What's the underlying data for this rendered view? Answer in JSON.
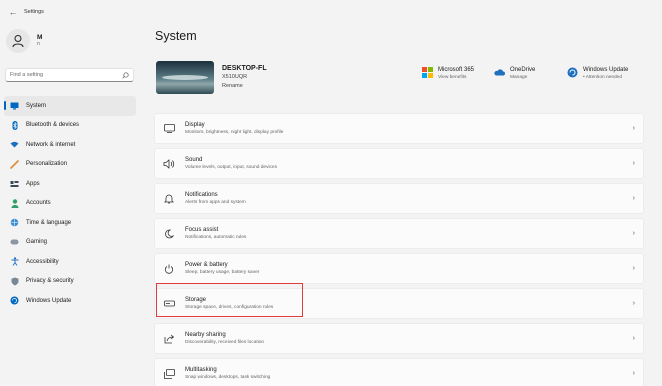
{
  "window": {
    "title": "Settings",
    "back_glyph": "←"
  },
  "user": {
    "name": "M",
    "sub": "n"
  },
  "search": {
    "placeholder": "Find a setting"
  },
  "nav": [
    {
      "label": "System",
      "icon": "monitor-icon",
      "active": true
    },
    {
      "label": "Bluetooth & devices",
      "icon": "bluetooth-icon"
    },
    {
      "label": "Network & internet",
      "icon": "network-icon"
    },
    {
      "label": "Personalization",
      "icon": "brush-icon"
    },
    {
      "label": "Apps",
      "icon": "apps-icon"
    },
    {
      "label": "Accounts",
      "icon": "accounts-icon"
    },
    {
      "label": "Time & language",
      "icon": "globe-clock-icon"
    },
    {
      "label": "Gaming",
      "icon": "gamepad-icon"
    },
    {
      "label": "Accessibility",
      "icon": "accessibility-icon"
    },
    {
      "label": "Privacy & security",
      "icon": "shield-icon"
    },
    {
      "label": "Windows Update",
      "icon": "update-icon"
    }
  ],
  "main": {
    "title": "System",
    "device": {
      "name": "DESKTOP-FL",
      "model": "X510UQR",
      "rename": "Rename"
    },
    "quick": [
      {
        "title": "Microsoft 365",
        "sub": "View benefits",
        "icon": "microsoft-logo-icon"
      },
      {
        "title": "OneDrive",
        "sub": "Manage",
        "icon": "cloud-icon"
      },
      {
        "title": "Windows Update",
        "sub": "• Attention needed",
        "icon": "update-icon"
      }
    ],
    "rows": [
      {
        "title": "Display",
        "sub": "Monitors, brightness, night light, display profile",
        "icon": "display-icon"
      },
      {
        "title": "Sound",
        "sub": "Volume levels, output, input, sound devices",
        "icon": "speaker-icon"
      },
      {
        "title": "Notifications",
        "sub": "Alerts from apps and system",
        "icon": "bell-icon"
      },
      {
        "title": "Focus assist",
        "sub": "Notifications, automatic rules",
        "icon": "moon-icon"
      },
      {
        "title": "Power & battery",
        "sub": "Sleep, battery usage, battery saver",
        "icon": "power-icon"
      },
      {
        "title": "Storage",
        "sub": "Storage space, drives, configuration rules",
        "icon": "storage-icon"
      },
      {
        "title": "Nearby sharing",
        "sub": "Discoverability, received files location",
        "icon": "share-icon"
      },
      {
        "title": "Multitasking",
        "sub": "Snap windows, desktops, task switching",
        "icon": "multitask-icon"
      }
    ],
    "chevron": "›"
  },
  "colors": {
    "accent": "#0067c0",
    "highlight": "#e23b3b"
  }
}
